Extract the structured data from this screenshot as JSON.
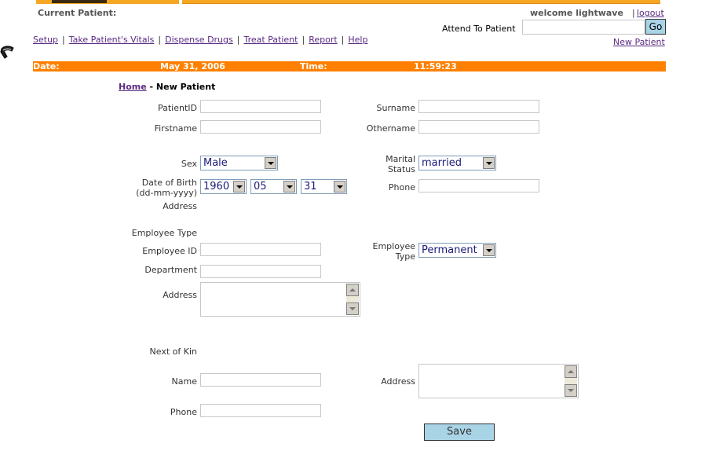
{
  "header": {
    "current_patient_label": "Current Patient:",
    "welcome_text": "welcome lightwave",
    "logout_label": "logout",
    "attend_label": "Attend To Patient",
    "attend_value": "",
    "go_label": "Go",
    "new_patient_label": "New Patient"
  },
  "nav": {
    "items": [
      {
        "label": "Setup"
      },
      {
        "label": "Take Patient's Vitals"
      },
      {
        "label": "Dispense Drugs"
      },
      {
        "label": "Treat Patient"
      },
      {
        "label": "Report"
      },
      {
        "label": "Help"
      }
    ],
    "separator": "|"
  },
  "datebar": {
    "date_label": "Date:",
    "date_value": "May 31, 2006",
    "time_label": "Time:",
    "time_value": "11:59:23",
    "color": "#ff8000"
  },
  "breadcrumb": {
    "home": "Home",
    "current": "- New Patient"
  },
  "form": {
    "patient_id": {
      "label": "PatientID",
      "value": ""
    },
    "surname": {
      "label": "Surname",
      "value": ""
    },
    "firstname": {
      "label": "Firstname",
      "value": ""
    },
    "othername": {
      "label": "Othername",
      "value": ""
    },
    "sex": {
      "label": "Sex",
      "value": "Male"
    },
    "marital_status": {
      "label_line1": "Marital",
      "label_line2": "Status",
      "value": "married"
    },
    "dob": {
      "label_line1": "Date of Birth",
      "label_line2": "(dd-mm-yyyy)",
      "year": "1960",
      "month": "05",
      "day": "31"
    },
    "phone": {
      "label": "Phone",
      "value": ""
    },
    "address_label": "Address",
    "employee_type_heading": "Employee Type",
    "employee_id": {
      "label": "Employee ID",
      "value": ""
    },
    "employee_type": {
      "label_line1": "Employee",
      "label_line2": "Type",
      "value": "Permanent"
    },
    "department": {
      "label": "Department",
      "value": ""
    },
    "employee_address": {
      "label": "Address",
      "value": ""
    },
    "next_of_kin_heading": "Next of Kin",
    "kin_name": {
      "label": "Name",
      "value": ""
    },
    "kin_address": {
      "label": "Address",
      "value": ""
    },
    "kin_phone": {
      "label": "Phone",
      "value": ""
    },
    "save_label": "Save"
  },
  "colors": {
    "accent_orange": "#ff8000",
    "link_purple": "#5a2a82",
    "button_blue": "#a9d4e6"
  },
  "icons": {
    "cursor": "hand-pointer-icon"
  }
}
